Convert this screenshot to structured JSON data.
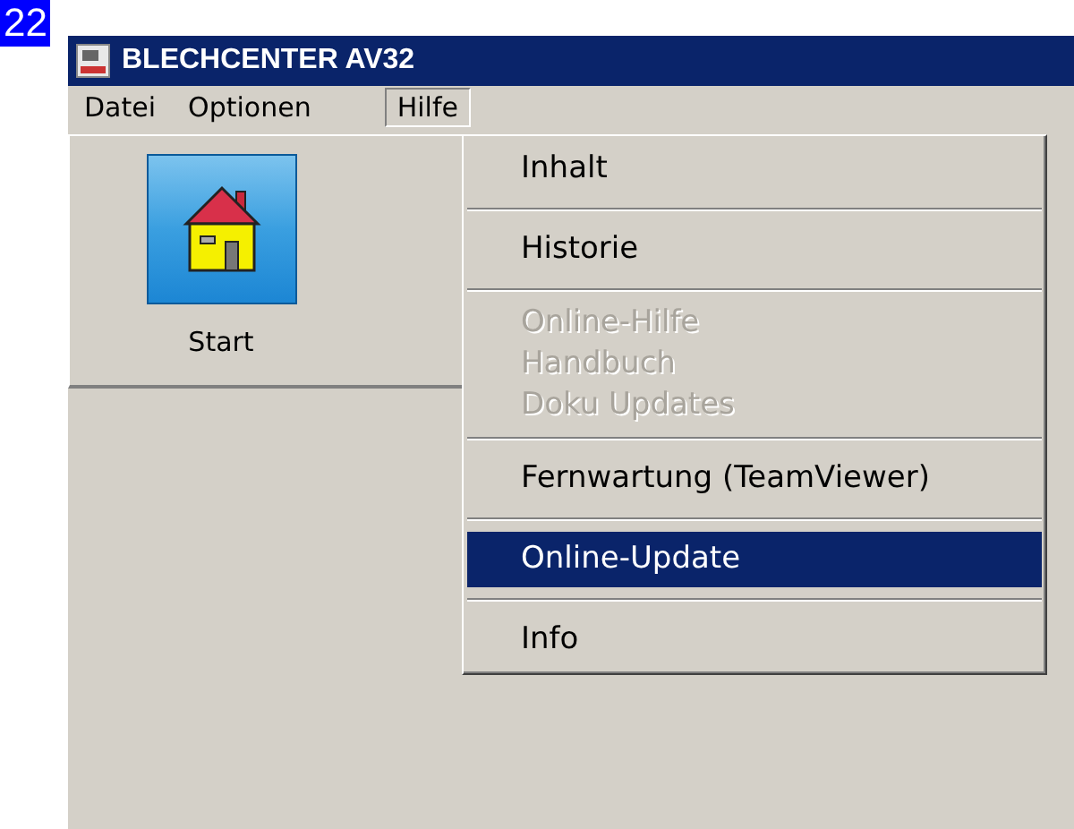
{
  "badge": "22",
  "window": {
    "title": "BLECHCENTER AV32"
  },
  "menubar": [
    {
      "label": "Datei",
      "selected": false
    },
    {
      "label": "Optionen",
      "selected": false
    },
    {
      "label": "Hilfe",
      "selected": true
    }
  ],
  "launcher": [
    {
      "label": "Start"
    }
  ],
  "menu": [
    {
      "kind": "item",
      "label": "Inhalt",
      "disabled": false,
      "selected": false
    },
    {
      "kind": "separator"
    },
    {
      "kind": "item",
      "label": "Historie",
      "disabled": false,
      "selected": false
    },
    {
      "kind": "separator"
    },
    {
      "kind": "item",
      "label": "Online-Hilfe",
      "disabled": true,
      "selected": false
    },
    {
      "kind": "item",
      "label": "Handbuch",
      "disabled": true,
      "selected": false
    },
    {
      "kind": "item",
      "label": "Doku Updates",
      "disabled": true,
      "selected": false
    },
    {
      "kind": "separator"
    },
    {
      "kind": "item",
      "label": "Fernwartung (TeamViewer)",
      "disabled": false,
      "selected": false
    },
    {
      "kind": "separator"
    },
    {
      "kind": "item",
      "label": "Online-Update",
      "disabled": false,
      "selected": true
    },
    {
      "kind": "separator"
    },
    {
      "kind": "item",
      "label": "Info",
      "disabled": false,
      "selected": false
    }
  ]
}
